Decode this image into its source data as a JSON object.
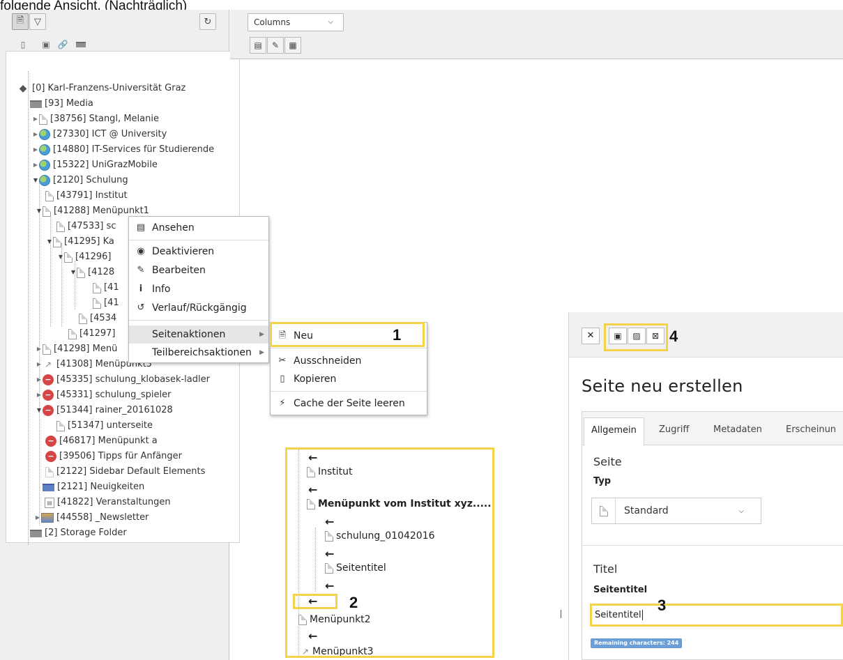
{
  "caption": "folgende Ansicht. (Nachträglich)",
  "left_toolbar": {
    "new_page_icon": "new-page-icon",
    "filter_icon": "filter-icon",
    "refresh_icon": "refresh-icon",
    "drag_icons": [
      "page-icon",
      "page-shortcut-icon",
      "link-icon",
      "folder-icon"
    ]
  },
  "tree": {
    "root": "[0] Karl-Franzens-Universität Graz",
    "items": [
      "[93] Media",
      "[38756] Stangl, Melanie",
      "[27330] ICT @ University",
      "[14880] IT-Services für Studierende",
      "[15322] UniGrazMobile",
      "[2120] Schulung",
      "[43791] Institut",
      "[41288] Menüpunkt1",
      "[47533] sc",
      "[41295] Ka",
      "[41296]",
      "[4128",
      "[41",
      "[41",
      "[4534",
      "[41297]",
      "[41298] Menü",
      "[41308] Menüpunkt3",
      "[45335] schulung_klobasek-ladler",
      "[45331] schulung_spieler",
      "[51344] rainer_20161028",
      "[51347] unterseite",
      "[46817] Menüpunkt a",
      "[39506] Tipps für Anfänger",
      "[2122] Sidebar Default Elements",
      "[2121] Neuigkeiten",
      "[41822] Veranstaltungen",
      "[44558] _Newsletter",
      "[2] Storage Folder"
    ]
  },
  "top_bar": {
    "view_select": "Columns",
    "view_buttons": [
      "view-page-icon",
      "edit-page-icon",
      "new-content-icon"
    ]
  },
  "context_menu": {
    "items": [
      "Ansehen",
      "Deaktivieren",
      "Bearbeiten",
      "Info",
      "Verlauf/Rückgängig",
      "Seitenaktionen",
      "Teilbereichsaktionen"
    ]
  },
  "sub_menu": {
    "items": [
      "Neu",
      "Ausschneiden",
      "Kopieren",
      "Cache der Seite leeren"
    ]
  },
  "annotations": [
    "1",
    "2",
    "3",
    "4"
  ],
  "preview_tree": {
    "items": [
      "Institut",
      "Menüpunkt vom Institut xyz......",
      "schulung_01042016",
      "Seitentitel",
      "Menüpunkt2",
      "Menüpunkt3"
    ]
  },
  "form": {
    "title": "Seite neu erstellen",
    "tabs": [
      "Allgemein",
      "Zugriff",
      "Metadaten",
      "Erscheinun"
    ],
    "section_page": "Seite",
    "type_label": "Typ",
    "type_value": "Standard",
    "section_title": "Titel",
    "page_title_label": "Seitentitel",
    "page_title_value": "Seitentitel",
    "remaining": "Remaining characters: 244"
  },
  "colors": {
    "highlight_yellow": "#f2d34a",
    "panel_gray": "#efefef",
    "badge_blue": "#6a9ed6"
  }
}
